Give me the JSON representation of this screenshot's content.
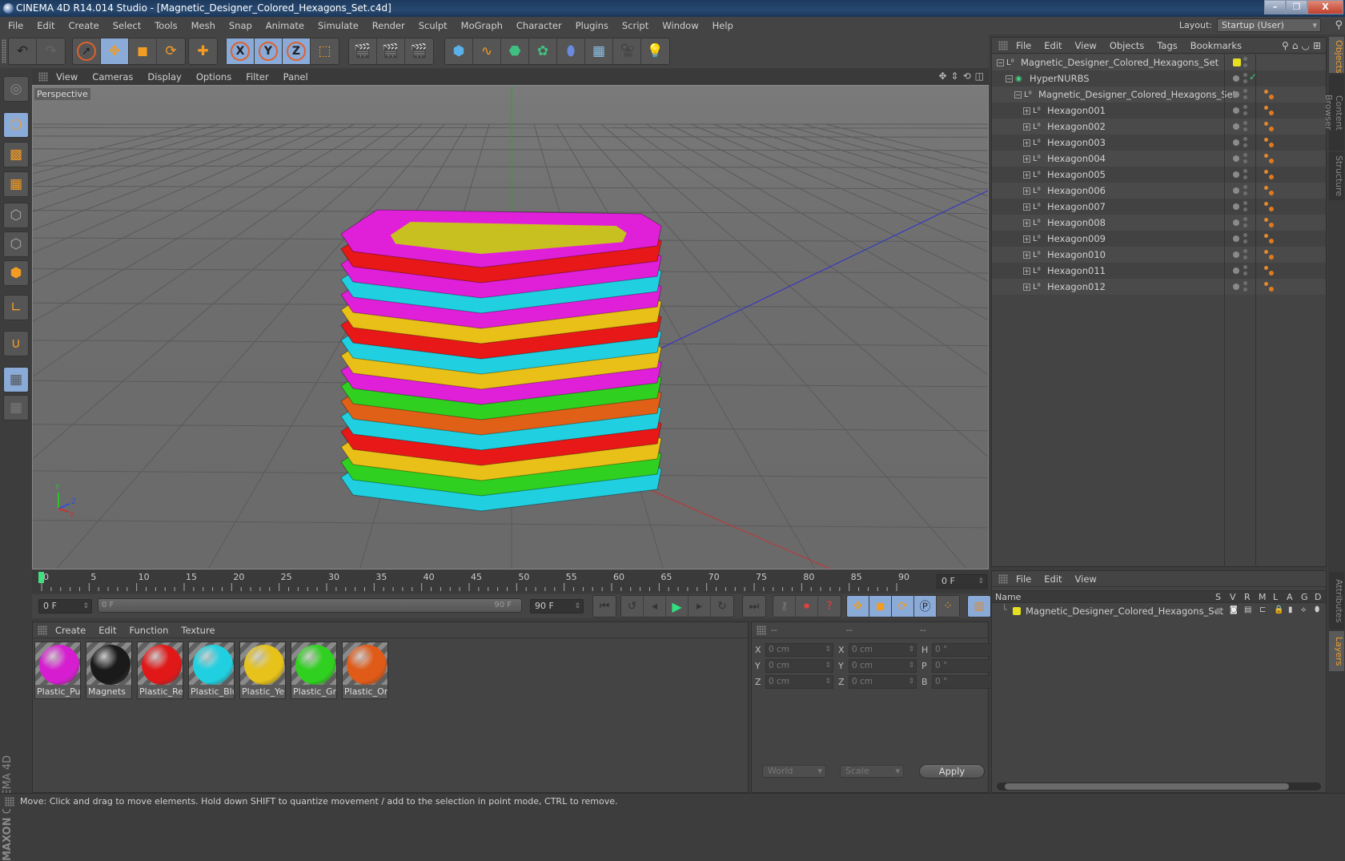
{
  "window": {
    "title": "CINEMA 4D R14.014 Studio - [Magnetic_Designer_Colored_Hexagons_Set.c4d]",
    "controls": [
      "minimize",
      "restore",
      "close"
    ]
  },
  "menubar": {
    "items": [
      "File",
      "Edit",
      "Create",
      "Select",
      "Tools",
      "Mesh",
      "Snap",
      "Animate",
      "Simulate",
      "Render",
      "Sculpt",
      "MoGraph",
      "Character",
      "Plugins",
      "Script",
      "Window",
      "Help"
    ],
    "layout_label": "Layout:",
    "layout_value": "Startup (User)"
  },
  "toolbar": {
    "groups": [
      {
        "name": "history",
        "tools": [
          "undo-icon",
          "redo-icon"
        ]
      },
      {
        "name": "transform",
        "tools": [
          "live-selection-icon",
          "move-icon",
          "scale-icon",
          "rotate-icon"
        ],
        "active": [
          "move-icon"
        ]
      },
      {
        "name": "create",
        "tools": [
          "add-icon"
        ]
      },
      {
        "name": "axis",
        "tools": [
          "x-axis-icon",
          "y-axis-icon",
          "z-axis-icon",
          "coordinate-system-icon"
        ],
        "active": [
          "x-axis-icon",
          "y-axis-icon",
          "z-axis-icon"
        ]
      },
      {
        "name": "render",
        "tools": [
          "render-view-icon",
          "render-picture-viewer-icon",
          "render-settings-icon"
        ]
      },
      {
        "name": "objects",
        "tools": [
          "cube-icon",
          "spline-icon",
          "nurbs-icon",
          "array-icon",
          "deformer-icon",
          "floor-icon",
          "camera-icon",
          "light-icon"
        ]
      }
    ]
  },
  "left_tools": [
    "make-editable-icon",
    "model-mode-icon",
    "texture-mode-icon",
    "workplane-mode-icon",
    "points-mode-icon",
    "edges-mode-icon",
    "polygons-mode-icon",
    "axis-mode-icon",
    "snap-icon",
    "workplane-lock-icon",
    "locked-workplane-icon"
  ],
  "brand": {
    "maxon": "MAXON",
    "product": "CINEMA 4D"
  },
  "viewport": {
    "menu": [
      "View",
      "Cameras",
      "Display",
      "Options",
      "Filter",
      "Panel"
    ],
    "label": "Perspective",
    "nav_icons": [
      "pan-icon",
      "dolly-icon",
      "rotate-view-icon",
      "toggle-layout-icon"
    ],
    "axis_labels": {
      "x": "X",
      "y": "Y",
      "z": "Z"
    },
    "ring_colors_top_to_bottom": [
      "#e020d8",
      "#e81818",
      "#e020d8",
      "#20d0e0",
      "#e020d8",
      "#e8c018",
      "#e81818",
      "#20d0e0",
      "#e8c018",
      "#e020d8",
      "#30d020",
      "#e06018",
      "#20d0e0",
      "#e81818",
      "#e8c018",
      "#30d020",
      "#20d0e0"
    ]
  },
  "timeline": {
    "ticks": [
      "0",
      "5",
      "10",
      "15",
      "20",
      "25",
      "30",
      "35",
      "40",
      "45",
      "50",
      "55",
      "60",
      "65",
      "70",
      "75",
      "80",
      "85",
      "90"
    ],
    "current_frame_display": "0 F",
    "start_field": "0 F",
    "range_start": "0 F",
    "range_end": "90 F",
    "end_field": "90 F",
    "playhead_frame": 0,
    "max_frame": 90
  },
  "playback": {
    "buttons": [
      "go-to-start-icon",
      "previous-key-icon",
      "previous-frame-icon",
      "play-icon",
      "next-frame-icon",
      "next-key-icon",
      "go-to-end-icon"
    ],
    "record": [
      "record-active-objects-icon",
      "autokeying-icon",
      "keyframe-selection-icon"
    ],
    "key_types": [
      "position-key-icon",
      "scale-key-icon",
      "rotation-key-icon",
      "parameter-key-icon",
      "pla-key-icon"
    ],
    "timeline_button": "timeline-icon"
  },
  "materials": {
    "menu": [
      "Create",
      "Edit",
      "Function",
      "Texture"
    ],
    "items": [
      {
        "label": "Plastic_Purp",
        "color": "#d61ed0"
      },
      {
        "label": "Magnets",
        "color": "#1a1a1a"
      },
      {
        "label": "Plastic_Red",
        "color": "#e01818"
      },
      {
        "label": "Plastic_Blue",
        "color": "#20d0e0"
      },
      {
        "label": "Plastic_Yello",
        "color": "#e6c21a"
      },
      {
        "label": "Plastic_Gre",
        "color": "#30d020"
      },
      {
        "label": "Plastic_Ora",
        "color": "#e05a18"
      }
    ]
  },
  "coordinates": {
    "headers": [
      "--",
      "--",
      "--"
    ],
    "rows": [
      {
        "l1": "X",
        "v1": "0 cm",
        "l2": "X",
        "v2": "0 cm",
        "l3": "H",
        "v3": "0 °"
      },
      {
        "l1": "Y",
        "v1": "0 cm",
        "l2": "Y",
        "v2": "0 cm",
        "l3": "P",
        "v3": "0 °"
      },
      {
        "l1": "Z",
        "v1": "0 cm",
        "l2": "Z",
        "v2": "0 cm",
        "l3": "B",
        "v3": "0 °"
      }
    ],
    "mode_select": "World",
    "transform_select": "Scale",
    "apply_label": "Apply"
  },
  "object_manager": {
    "menu": [
      "File",
      "Edit",
      "View",
      "Objects",
      "Tags",
      "Bookmarks"
    ],
    "objects": [
      {
        "name": "Magnetic_Designer_Colored_Hexagons_Set",
        "level": 0,
        "expand": "−",
        "icon": "null",
        "layer_color": "#e6e020"
      },
      {
        "name": "HyperNURBS",
        "level": 1,
        "expand": "−",
        "icon": "hypernurbs",
        "check": "✓"
      },
      {
        "name": "Magnetic_Designer_Colored_Hexagons_Set",
        "level": 2,
        "expand": "−",
        "icon": "null",
        "tag": true
      },
      {
        "name": "Hexagon001",
        "level": 3,
        "expand": "+",
        "icon": "null",
        "tag": true
      },
      {
        "name": "Hexagon002",
        "level": 3,
        "expand": "+",
        "icon": "null",
        "tag": true
      },
      {
        "name": "Hexagon003",
        "level": 3,
        "expand": "+",
        "icon": "null",
        "tag": true
      },
      {
        "name": "Hexagon004",
        "level": 3,
        "expand": "+",
        "icon": "null",
        "tag": true
      },
      {
        "name": "Hexagon005",
        "level": 3,
        "expand": "+",
        "icon": "null",
        "tag": true
      },
      {
        "name": "Hexagon006",
        "level": 3,
        "expand": "+",
        "icon": "null",
        "tag": true
      },
      {
        "name": "Hexagon007",
        "level": 3,
        "expand": "+",
        "icon": "null",
        "tag": true
      },
      {
        "name": "Hexagon008",
        "level": 3,
        "expand": "+",
        "icon": "null",
        "tag": true
      },
      {
        "name": "Hexagon009",
        "level": 3,
        "expand": "+",
        "icon": "null",
        "tag": true
      },
      {
        "name": "Hexagon010",
        "level": 3,
        "expand": "+",
        "icon": "null",
        "tag": true
      },
      {
        "name": "Hexagon011",
        "level": 3,
        "expand": "+",
        "icon": "null",
        "tag": true
      },
      {
        "name": "Hexagon012",
        "level": 3,
        "expand": "+",
        "icon": "null",
        "tag": true
      }
    ]
  },
  "side_tabs": {
    "top": [
      "Objects",
      "Content Browser",
      "Structure"
    ],
    "bottom": [
      "Attributes",
      "Layers"
    ],
    "active_top": "Objects",
    "active_bottom": "Layers"
  },
  "layers": {
    "menu": [
      "File",
      "Edit",
      "View"
    ],
    "columns": [
      "Name",
      "S",
      "V",
      "R",
      "M",
      "L",
      "A",
      "G",
      "D"
    ],
    "rows": [
      {
        "name": "Magnetic_Designer_Colored_Hexagons_Set",
        "color": "#e6e020"
      }
    ]
  },
  "status": {
    "text": "Move: Click and drag to move elements. Hold down SHIFT to quantize movement / add to the selection in point mode, CTRL to remove."
  }
}
